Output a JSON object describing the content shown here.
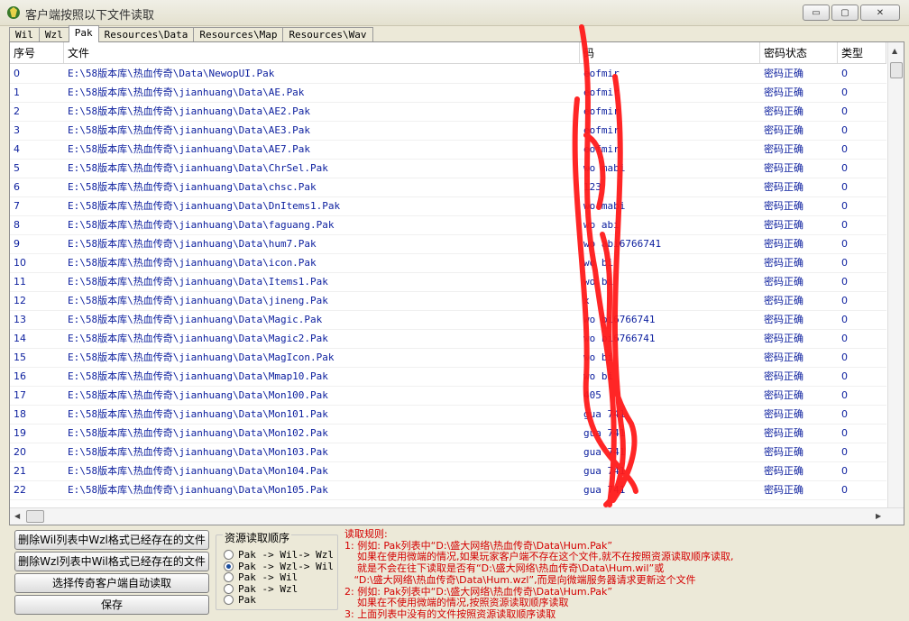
{
  "window": {
    "title": "客户端按照以下文件读取",
    "buttons": {
      "minimize": "▭",
      "maximize": "▢",
      "close": "✕"
    }
  },
  "tabs": [
    {
      "label": "Wil",
      "active": false
    },
    {
      "label": "Wzl",
      "active": false
    },
    {
      "label": "Pak",
      "active": true
    },
    {
      "label": "Resources\\Data",
      "active": false
    },
    {
      "label": "Resources\\Map",
      "active": false
    },
    {
      "label": "Resources\\Wav",
      "active": false
    }
  ],
  "table": {
    "headers": [
      "序号",
      "文件",
      "码",
      "密码状态",
      "类型"
    ],
    "rows": [
      {
        "idx": "0",
        "file": "E:\\58版本库\\热血传奇\\Data\\NewopUI.Pak",
        "pwd": "eofmir",
        "status": "密码正确",
        "type": "0"
      },
      {
        "idx": "1",
        "file": "E:\\58版本库\\热血传奇\\jianhuang\\Data\\AE.Pak",
        "pwd": "eofmir",
        "status": "密码正确",
        "type": "0"
      },
      {
        "idx": "2",
        "file": "E:\\58版本库\\热血传奇\\jianhuang\\Data\\AE2.Pak",
        "pwd": "eofmir",
        "status": "密码正确",
        "type": "0"
      },
      {
        "idx": "3",
        "file": "E:\\58版本库\\热血传奇\\jianhuang\\Data\\AE3.Pak",
        "pwd": "eofmir",
        "status": "密码正确",
        "type": "0"
      },
      {
        "idx": "4",
        "file": "E:\\58版本库\\热血传奇\\jianhuang\\Data\\AE7.Pak",
        "pwd": "eofmir",
        "status": "密码正确",
        "type": "0"
      },
      {
        "idx": "5",
        "file": "E:\\58版本库\\热血传奇\\jianhuang\\Data\\ChrSel.Pak",
        "pwd": "wo     mabi",
        "status": "密码正确",
        "type": "0"
      },
      {
        "idx": "6",
        "file": "E:\\58版本库\\热血传奇\\jianhuang\\Data\\chsc.Pak",
        "pwd": "123",
        "status": "密码正确",
        "type": "0"
      },
      {
        "idx": "7",
        "file": "E:\\58版本库\\热血传奇\\jianhuang\\Data\\DnItems1.Pak",
        "pwd": "wo    mabi",
        "status": "密码正确",
        "type": "0"
      },
      {
        "idx": "8",
        "file": "E:\\58版本库\\热血传奇\\jianhuang\\Data\\faguang.Pak",
        "pwd": "wo    abi",
        "status": "密码正确",
        "type": "0"
      },
      {
        "idx": "9",
        "file": "E:\\58版本库\\热血传奇\\jianhuang\\Data\\hum7.Pak",
        "pwd": "wo    abi6766741",
        "status": "密码正确",
        "type": "0"
      },
      {
        "idx": "10",
        "file": "E:\\58版本库\\热血传奇\\jianhuang\\Data\\icon.Pak",
        "pwd": "wo    bi",
        "status": "密码正确",
        "type": "0"
      },
      {
        "idx": "11",
        "file": "E:\\58版本库\\热血传奇\\jianhuang\\Data\\Items1.Pak",
        "pwd": "wo    bi",
        "status": "密码正确",
        "type": "0"
      },
      {
        "idx": "12",
        "file": "E:\\58版本库\\热血传奇\\jianhuang\\Data\\jineng.Pak",
        "pwd": "x",
        "status": "密码正确",
        "type": "0"
      },
      {
        "idx": "13",
        "file": "E:\\58版本库\\热血传奇\\jianhuang\\Data\\Magic.Pak",
        "pwd": "wo    bi6766741",
        "status": "密码正确",
        "type": "0"
      },
      {
        "idx": "14",
        "file": "E:\\58版本库\\热血传奇\\jianhuang\\Data\\Magic2.Pak",
        "pwd": "wo    bi6766741",
        "status": "密码正确",
        "type": "0"
      },
      {
        "idx": "15",
        "file": "E:\\58版本库\\热血传奇\\jianhuang\\Data\\MagIcon.Pak",
        "pwd": "wo    bi",
        "status": "密码正确",
        "type": "0"
      },
      {
        "idx": "16",
        "file": "E:\\58版本库\\热血传奇\\jianhuang\\Data\\Mmap10.Pak",
        "pwd": "wo    bi",
        "status": "密码正确",
        "type": "0"
      },
      {
        "idx": "17",
        "file": "E:\\58版本库\\热血传奇\\jianhuang\\Data\\Mon100.Pak",
        "pwd": "405",
        "status": "密码正确",
        "type": "0"
      },
      {
        "idx": "18",
        "file": "E:\\58版本库\\热血传奇\\jianhuang\\Data\\Mon101.Pak",
        "pwd": "gua    741",
        "status": "密码正确",
        "type": "0"
      },
      {
        "idx": "19",
        "file": "E:\\58版本库\\热血传奇\\jianhuang\\Data\\Mon102.Pak",
        "pwd": "gua    741",
        "status": "密码正确",
        "type": "0"
      },
      {
        "idx": "20",
        "file": "E:\\58版本库\\热血传奇\\jianhuang\\Data\\Mon103.Pak",
        "pwd": "gua    741",
        "status": "密码正确",
        "type": "0"
      },
      {
        "idx": "21",
        "file": "E:\\58版本库\\热血传奇\\jianhuang\\Data\\Mon104.Pak",
        "pwd": "gua    741",
        "status": "密码正确",
        "type": "0"
      },
      {
        "idx": "22",
        "file": "E:\\58版本库\\热血传奇\\jianhuang\\Data\\Mon105.Pak",
        "pwd": "gua    741",
        "status": "密码正确",
        "type": "0"
      }
    ]
  },
  "buttons": {
    "delete_wil": "删除Wil列表中Wzl格式已经存在的文件",
    "delete_wzl": "删除Wzl列表中Wil格式已经存在的文件",
    "auto_read": "选择传奇客户端自动读取",
    "save": "保存"
  },
  "resource_order": {
    "title": "资源读取顺序",
    "options": [
      {
        "label": "Pak -> Wil-> Wzl",
        "selected": false
      },
      {
        "label": "Pak -> Wzl-> Wil",
        "selected": true
      },
      {
        "label": "Pak -> Wil",
        "selected": false
      },
      {
        "label": "Pak -> Wzl",
        "selected": false
      },
      {
        "label": "Pak",
        "selected": false
      }
    ]
  },
  "rules": {
    "lines": [
      "读取规则:",
      "1: 例如: Pak列表中“D:\\盛大网络\\热血传奇\\Data\\Hum.Pak”",
      "    如果在使用微端的情况,如果玩家客户端不存在这个文件,就不在按照资源读取顺序读取,",
      "    就是不会在往下读取是否有“D:\\盛大网络\\热血传奇\\Data\\Hum.wil”或",
      "   “D:\\盛大网络\\热血传奇\\Data\\Hum.wzl”,而是向微端服务器请求更新这个文件",
      "2: 例如: Pak列表中“D:\\盛大网络\\热血传奇\\Data\\Hum.Pak”",
      "    如果在不使用微端的情况,按照资源读取顺序读取",
      "3: 上面列表中没有的文件按照资源读取顺序读取"
    ]
  },
  "colors": {
    "row_text": "#0b1e9e",
    "rules_text": "#d40000",
    "scribble": "#ff1a1a"
  }
}
